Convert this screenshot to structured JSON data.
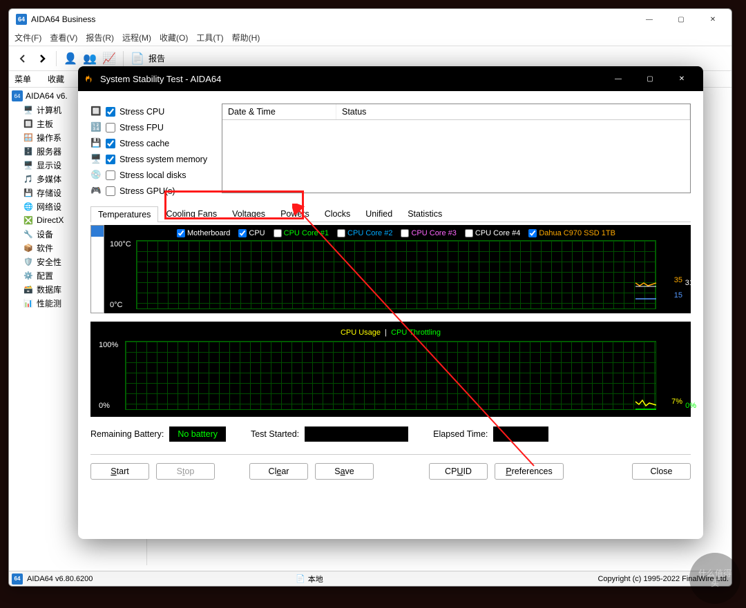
{
  "mainWindow": {
    "title": "AIDA64 Business",
    "logo": "64",
    "menu": [
      "文件(F)",
      "查看(V)",
      "报告(R)",
      "远程(M)",
      "收藏(O)",
      "工具(T)",
      "帮助(H)"
    ],
    "toolbar": {
      "report": "报告"
    },
    "sideHeader": [
      "菜单",
      "收藏"
    ],
    "tree": {
      "root": "AIDA64 v6.",
      "items": [
        "计算机",
        "主板",
        "操作系",
        "服务器",
        "显示设",
        "多媒体",
        "存储设",
        "网络设",
        "DirectX",
        "设备",
        "软件",
        "安全性",
        "配置",
        "数据库",
        "性能测"
      ]
    },
    "treeIcons": [
      "🖥️",
      "🔲",
      "🪟",
      "🗄️",
      "🖥️",
      "🎵",
      "💾",
      "🌐",
      "❎",
      "🔧",
      "📦",
      "🛡️",
      "⚙️",
      "🗃️",
      "📊"
    ]
  },
  "statusbar": {
    "left": "AIDA64 v6.80.6200",
    "center": "本地",
    "right": "Copyright (c) 1995-2022 FinalWire Ltd."
  },
  "dialog": {
    "title": "System Stability Test - AIDA64",
    "stressItems": [
      {
        "label": "Stress CPU",
        "checked": true
      },
      {
        "label": "Stress FPU",
        "checked": false
      },
      {
        "label": "Stress cache",
        "checked": true
      },
      {
        "label": "Stress system memory",
        "checked": true
      },
      {
        "label": "Stress local disks",
        "checked": false
      },
      {
        "label": "Stress GPU(s)",
        "checked": false
      }
    ],
    "statusCols": [
      "Date & Time",
      "Status"
    ],
    "tabs": [
      "Temperatures",
      "Cooling Fans",
      "Voltages",
      "Powers",
      "Clocks",
      "Unified",
      "Statistics"
    ],
    "tempLegend": [
      {
        "label": "Motherboard",
        "color": "#ffffff",
        "checked": true
      },
      {
        "label": "CPU",
        "color": "#ffffff",
        "checked": true
      },
      {
        "label": "CPU Core #1",
        "color": "#00ff00",
        "checked": false
      },
      {
        "label": "CPU Core #2",
        "color": "#00aaff",
        "checked": false
      },
      {
        "label": "CPU Core #3",
        "color": "#ff66ff",
        "checked": false
      },
      {
        "label": "CPU Core #4",
        "color": "#ffffff",
        "checked": false
      },
      {
        "label": "Dahua C970 SSD 1TB",
        "color": "#ffaa00",
        "checked": true
      }
    ],
    "tempYhigh": "100°C",
    "tempYlow": "0°C",
    "tempReadings": [
      {
        "text": "35",
        "color": "#ffaa00"
      },
      {
        "text": "31",
        "color": "#ffffff"
      },
      {
        "text": "15",
        "color": "#5599ff"
      }
    ],
    "usageLegend": [
      {
        "label": "CPU Usage",
        "color": "#ffff00"
      },
      {
        "label": "CPU Throttling",
        "color": "#00ff00"
      }
    ],
    "usageYhigh": "100%",
    "usageYlow": "0%",
    "usageReadings": [
      {
        "text": "7%",
        "color": "#ffff00"
      },
      {
        "text": "0%",
        "color": "#00ff00"
      }
    ],
    "info": {
      "batteryLabel": "Remaining Battery:",
      "batteryValue": "No battery",
      "startedLabel": "Test Started:",
      "startedValue": "",
      "elapsedLabel": "Elapsed Time:",
      "elapsedValue": ""
    },
    "buttons": {
      "start": "Start",
      "stop": "Stop",
      "clear": "Clear",
      "save": "Save",
      "cpuid": "CPUID",
      "prefs": "Preferences",
      "close": "Close"
    }
  },
  "watermark": "什么值得买"
}
